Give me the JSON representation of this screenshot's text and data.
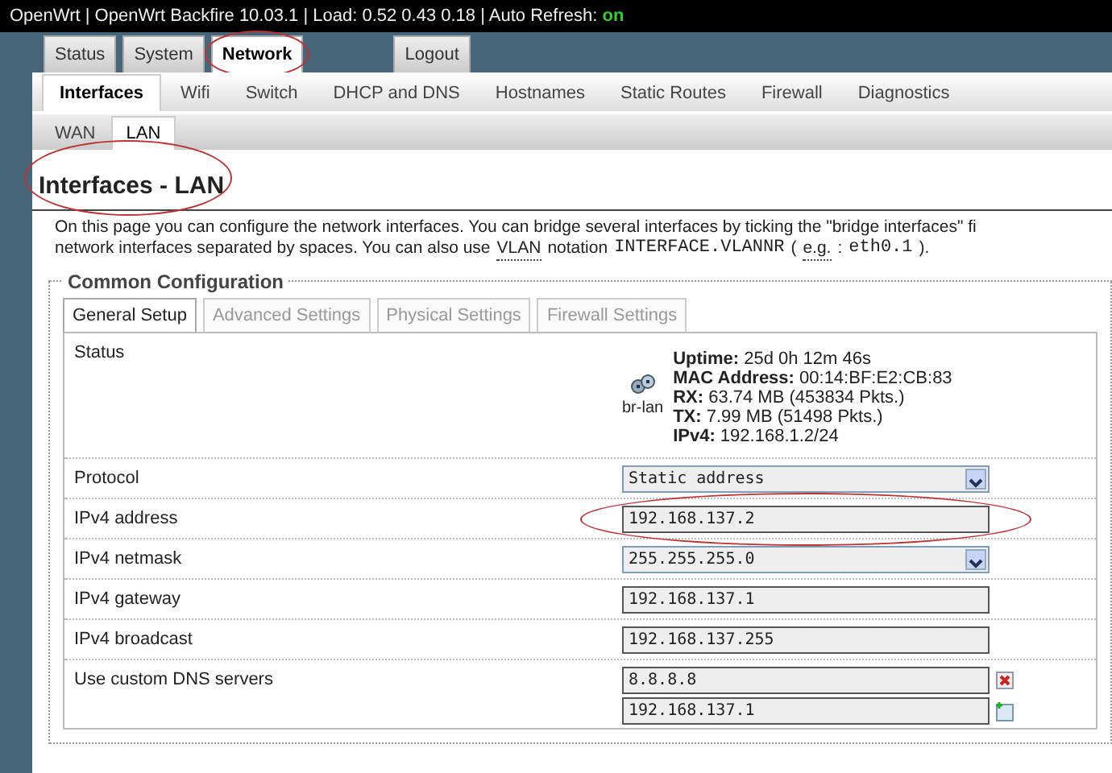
{
  "header": {
    "segments": [
      "OpenWrt | OpenWrt Backfire 10.03.1 | Load: 0.52 0.43 0.18 | Auto Refresh: "
    ],
    "auto_refresh": "on"
  },
  "main_tabs": [
    {
      "label": "Status",
      "selected": false,
      "circled": false
    },
    {
      "label": "System",
      "selected": false,
      "circled": false
    },
    {
      "label": "Network",
      "selected": true,
      "circled": true
    },
    {
      "label": "Logout",
      "selected": false,
      "circled": false
    }
  ],
  "sub_tabs": [
    {
      "label": "Interfaces",
      "selected": true
    },
    {
      "label": "Wifi",
      "selected": false
    },
    {
      "label": "Switch",
      "selected": false
    },
    {
      "label": "DHCP and DNS",
      "selected": false
    },
    {
      "label": "Hostnames",
      "selected": false
    },
    {
      "label": "Static Routes",
      "selected": false
    },
    {
      "label": "Firewall",
      "selected": false
    },
    {
      "label": "Diagnostics",
      "selected": false
    }
  ],
  "interface_tabs": [
    {
      "label": "WAN",
      "selected": false
    },
    {
      "label": "LAN",
      "selected": true
    }
  ],
  "page_title": {
    "text": "Interfaces - LAN",
    "circled": true
  },
  "description": [
    [
      {
        "kind": "plain",
        "text": "On this page you can configure the network interfaces. You can bridge several interfaces by ticking the \"bridge interfaces\" fi"
      }
    ],
    [
      {
        "kind": "plain",
        "text": "network interfaces separated by spaces. You can also use"
      },
      {
        "kind": "abbr",
        "text": "VLAN"
      },
      {
        "kind": "plain",
        "text": "notation"
      },
      {
        "kind": "code",
        "text": "INTERFACE.VLANNR"
      },
      {
        "kind": "plain",
        "text": "("
      },
      {
        "kind": "abbr",
        "text": "e.g."
      },
      {
        "kind": "plain",
        "text": ":"
      },
      {
        "kind": "code",
        "text": "eth0.1"
      },
      {
        "kind": "plain",
        "text": ")."
      }
    ]
  ],
  "section": {
    "legend": "Common Configuration",
    "tabs": [
      {
        "label": "General Setup",
        "selected": true
      },
      {
        "label": "Advanced Settings",
        "selected": false
      },
      {
        "label": "Physical Settings",
        "selected": false
      },
      {
        "label": "Firewall Settings",
        "selected": false
      }
    ],
    "status": {
      "label": "Status",
      "device": "br-lan",
      "lines": [
        "**Uptime:** 25d 0h 12m 46s",
        "**MAC Address:** 00:14:BF:E2:CB:83",
        "**RX:** 63.74 MB (453834 Pkts.)",
        "**TX:** 7.99 MB (51498 Pkts.)",
        "**IPv4:** 192.168.1.2/24"
      ]
    },
    "fields": [
      {
        "kind": "select",
        "label": "Protocol",
        "value": "Static address",
        "circled": false
      },
      {
        "kind": "text",
        "label": "IPv4 address",
        "value": "192.168.137.2",
        "circled": true
      },
      {
        "kind": "select",
        "label": "IPv4 netmask",
        "value": "255.255.255.0",
        "circled": false
      },
      {
        "kind": "text",
        "label": "IPv4 gateway",
        "value": "192.168.137.1",
        "circled": false
      },
      {
        "kind": "text",
        "label": "IPv4 broadcast",
        "value": "192.168.137.255",
        "circled": false
      },
      {
        "kind": "list",
        "label": "Use custom DNS servers",
        "entries": [
          {
            "value": "8.8.8.8",
            "kind": "remove"
          },
          {
            "value": "192.168.137.1",
            "kind": "add"
          }
        ],
        "circled": false
      }
    ]
  }
}
